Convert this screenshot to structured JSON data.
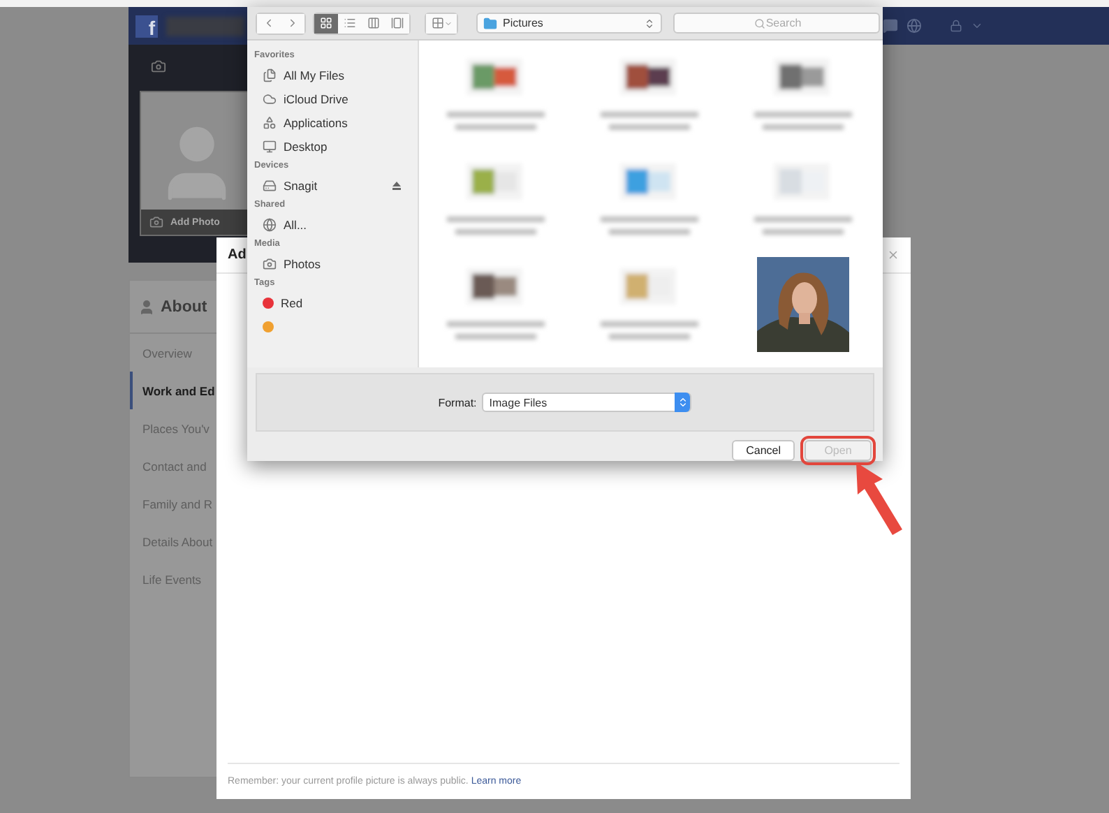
{
  "header": {
    "logo": "f"
  },
  "profile": {
    "add_photo": "Add Photo"
  },
  "about": {
    "title": "About",
    "items": [
      {
        "label": "Overview",
        "selected": false
      },
      {
        "label": "Work and Ed",
        "selected": true
      },
      {
        "label": "Places You'v",
        "selected": false
      },
      {
        "label": "Contact and",
        "selected": false
      },
      {
        "label": "Family and R",
        "selected": false
      },
      {
        "label": "Details About",
        "selected": false
      },
      {
        "label": "Life Events",
        "selected": false
      }
    ]
  },
  "dialog": {
    "title": "Ad",
    "footer": "Remember: your current profile picture is always public.",
    "footer_link": "Learn more"
  },
  "file_dialog": {
    "view_modes": [
      {
        "kind": "icon",
        "selected": true
      },
      {
        "kind": "list",
        "selected": false
      },
      {
        "kind": "columns",
        "selected": false
      },
      {
        "kind": "coverflow",
        "selected": false
      }
    ],
    "location": "Pictures",
    "search": {
      "placeholder": "Search"
    },
    "sidebar": [
      {
        "heading": "Favorites",
        "items": [
          {
            "label": "All My Files",
            "kind": "files"
          },
          {
            "label": "iCloud Drive",
            "kind": "cloud"
          },
          {
            "label": "Applications",
            "kind": "apps"
          },
          {
            "label": "Desktop",
            "kind": "desktop"
          }
        ]
      },
      {
        "heading": "Devices",
        "items": [
          {
            "label": "Snagit",
            "kind": "disk",
            "ejectable": true
          }
        ]
      },
      {
        "heading": "Shared",
        "items": [
          {
            "label": "All...",
            "kind": "network"
          }
        ]
      },
      {
        "heading": "Media",
        "items": [
          {
            "label": "Photos",
            "kind": "camera"
          }
        ]
      },
      {
        "heading": "Tags",
        "items": [
          {
            "label": "Red",
            "kind": "tag",
            "color": "#e8333a"
          },
          {
            "kind": "tag",
            "color": "#f0a030"
          }
        ]
      }
    ],
    "format_label": "Format:",
    "format": "Image Files",
    "buttons": [
      {
        "label": "Cancel",
        "disabled": false
      },
      {
        "label": "Open",
        "disabled": true,
        "highlighted": true
      }
    ]
  }
}
